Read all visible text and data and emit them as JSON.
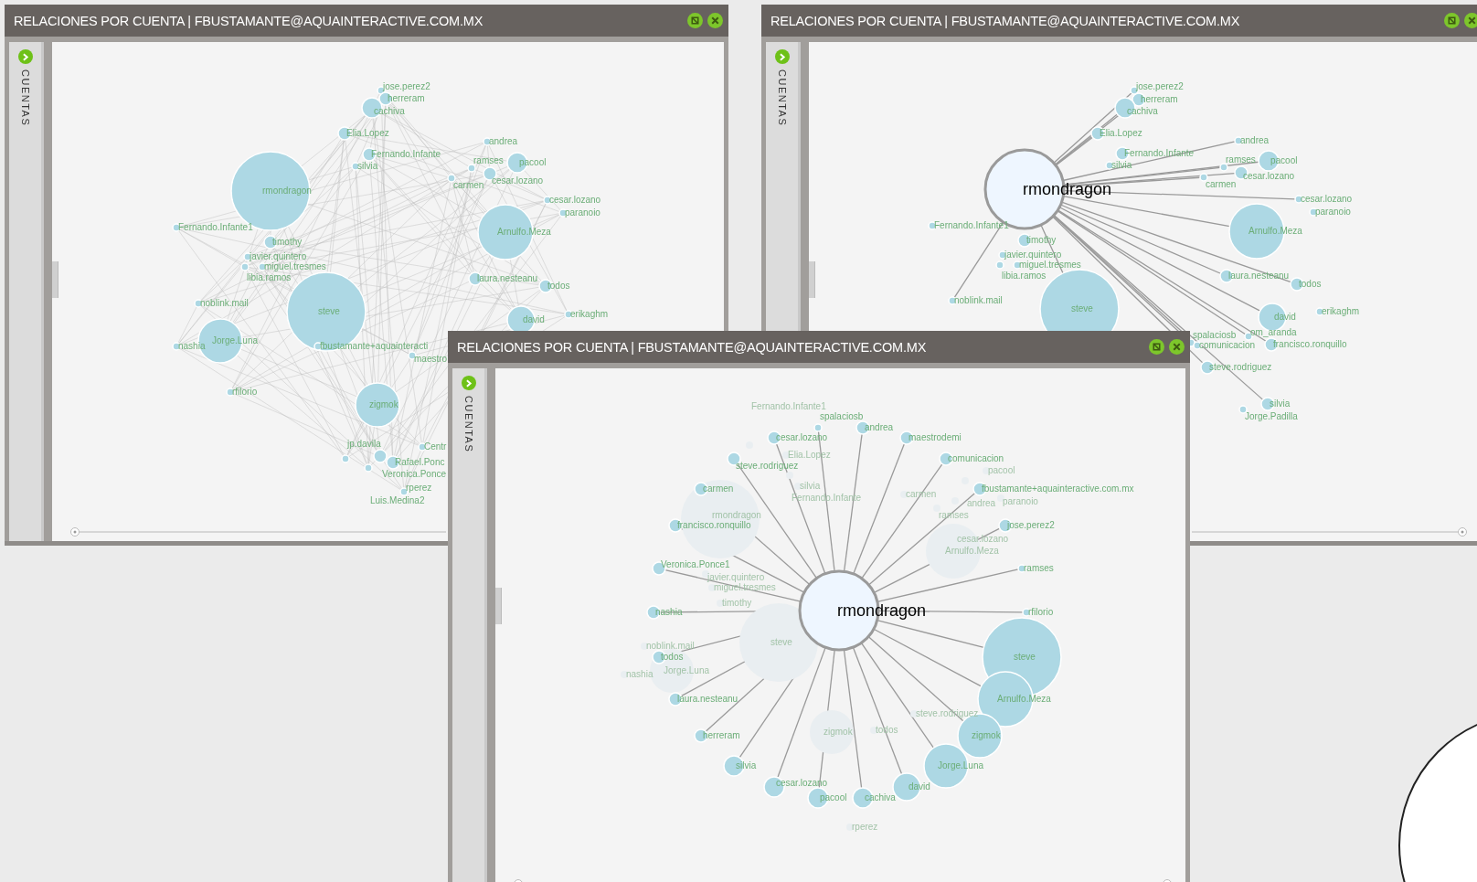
{
  "windows": [
    {
      "title": "RELACIONES POR CUENTA | FBUSTAMANTE@AQUAINTERACTIVE.COM.MX",
      "sidebar_label": "CUENTAS",
      "nodes": [
        {
          "label": "jose.perez2",
          "kind": "dot"
        },
        {
          "label": "herreram",
          "kind": "minor"
        },
        {
          "label": "cachiva",
          "kind": "small"
        },
        {
          "label": "Elia.Lopez",
          "kind": "minor"
        },
        {
          "label": "andrea",
          "kind": "dot"
        },
        {
          "label": "Fernando.Infante",
          "kind": "minor"
        },
        {
          "label": "silvia",
          "kind": "dot"
        },
        {
          "label": "ramses",
          "kind": "dot"
        },
        {
          "label": "pacool",
          "kind": "small"
        },
        {
          "label": "cesar.lozano",
          "kind": "minor"
        },
        {
          "label": "carmen",
          "kind": "dot"
        },
        {
          "label": "rmondragon",
          "kind": "huge"
        },
        {
          "label": "cesar.lozano",
          "kind": "dot"
        },
        {
          "label": "paranoio",
          "kind": "dot"
        },
        {
          "label": "Fernando.Infante1",
          "kind": "dot"
        },
        {
          "label": "Arnulfo.Meza",
          "kind": "large"
        },
        {
          "label": "timothy",
          "kind": "minor"
        },
        {
          "label": "javier.quintero",
          "kind": "dot"
        },
        {
          "label": "miguel.tresmes",
          "kind": "dot"
        },
        {
          "label": "libia.ramos",
          "kind": "dot"
        },
        {
          "label": "laura.nesteanu",
          "kind": "minor"
        },
        {
          "label": "todos",
          "kind": "minor"
        },
        {
          "label": "noblink.mail",
          "kind": "dot"
        },
        {
          "label": "steve",
          "kind": "huge"
        },
        {
          "label": "erikaghm",
          "kind": "dot"
        },
        {
          "label": "david",
          "kind": "medium"
        },
        {
          "label": "Jorge.Luna",
          "kind": "big"
        },
        {
          "label": "nashia",
          "kind": "dot"
        },
        {
          "label": "fbustamante+aquainteracti",
          "kind": "dot"
        },
        {
          "label": "maestro",
          "kind": "dot"
        },
        {
          "label": "rfilorio",
          "kind": "dot"
        },
        {
          "label": "zigmok",
          "kind": "big"
        },
        {
          "label": "Centr",
          "kind": "dot"
        },
        {
          "label": "Veronica.Ponce",
          "kind": "minor"
        },
        {
          "label": "jp.davila",
          "kind": "dot"
        },
        {
          "label": "Rafael.Ponc",
          "kind": "minor"
        },
        {
          "label": "Luis.Medina2",
          "kind": "dot"
        },
        {
          "label": "rperez",
          "kind": "dot"
        }
      ]
    },
    {
      "title": "RELACIONES POR CUENTA | FBUSTAMANTE@AQUAINTERACTIVE.COM.MX",
      "sidebar_label": "CUENTAS",
      "focus": {
        "label": "rmondragon",
        "kind": "huge",
        "neighbors": [
          {
            "label": "jose.perez2",
            "kind": "dot"
          },
          {
            "label": "herreram",
            "kind": "minor"
          },
          {
            "label": "cachiva",
            "kind": "small"
          },
          {
            "label": "Elia.Lopez",
            "kind": "minor"
          },
          {
            "label": "andrea",
            "kind": "dot"
          },
          {
            "label": "pacool",
            "kind": "small"
          },
          {
            "label": "ramses",
            "kind": "dot"
          },
          {
            "label": "cesar.lozano",
            "kind": "minor"
          },
          {
            "label": "carmen",
            "kind": "dot"
          },
          {
            "label": "cesar.lozano",
            "kind": "dot"
          },
          {
            "label": "Arnulfo.Meza",
            "kind": "large"
          },
          {
            "label": "laura.nesteanu",
            "kind": "minor"
          },
          {
            "label": "todos",
            "kind": "minor"
          },
          {
            "label": "noblink.mail",
            "kind": "dot"
          },
          {
            "label": "steve",
            "kind": "huge"
          },
          {
            "label": "david",
            "kind": "medium"
          },
          {
            "label": "om_aranda",
            "kind": "dot"
          },
          {
            "label": "spalaciosb",
            "kind": "dot"
          },
          {
            "label": "comunicacion",
            "kind": "dot"
          },
          {
            "label": "francisco.ronquillo",
            "kind": "minor"
          },
          {
            "label": "steve.rodriguez",
            "kind": "minor"
          },
          {
            "label": "silvia",
            "kind": "minor"
          }
        ]
      },
      "nodes": [
        {
          "label": "Fernando.Infante",
          "kind": "minor"
        },
        {
          "label": "silvia",
          "kind": "dot"
        },
        {
          "label": "paranoio",
          "kind": "dot"
        },
        {
          "label": "Fernando.Infante1",
          "kind": "dot"
        },
        {
          "label": "timothy",
          "kind": "minor"
        },
        {
          "label": "javier.quintero",
          "kind": "dot"
        },
        {
          "label": "miguel.tresmes",
          "kind": "dot"
        },
        {
          "label": "libia.ramos",
          "kind": "dot"
        },
        {
          "label": "erikaghm",
          "kind": "dot"
        },
        {
          "label": "Jorge.Padilla",
          "kind": "dot"
        }
      ]
    },
    {
      "title": "RELACIONES POR CUENTA | FBUSTAMANTE@AQUAINTERACTIVE.COM.MX",
      "sidebar_label": "CUENTAS",
      "background_nodes": [
        {
          "label": "Fernando.Infante1",
          "kind": "dot"
        },
        {
          "label": "Elia.Lopez",
          "kind": "dot"
        },
        {
          "label": "pacool",
          "kind": "dot"
        },
        {
          "label": "Fernando.Infante",
          "kind": "dot"
        },
        {
          "label": "andrea",
          "kind": "dot"
        },
        {
          "label": "silvia",
          "kind": "dot"
        },
        {
          "label": "carmen",
          "kind": "dot"
        },
        {
          "label": "paranoio",
          "kind": "dot"
        },
        {
          "label": "cesar.lozano",
          "kind": "dot"
        },
        {
          "label": "ramses",
          "kind": "dot"
        },
        {
          "label": "rmondragon",
          "kind": "huge"
        },
        {
          "label": "Arnulfo.Meza",
          "kind": "large"
        },
        {
          "label": "javier.quintero",
          "kind": "dot"
        },
        {
          "label": "miguel.tresmes",
          "kind": "dot"
        },
        {
          "label": "timothy",
          "kind": "dot"
        },
        {
          "label": "steve",
          "kind": "huge"
        },
        {
          "label": "noblink.mail",
          "kind": "dot"
        },
        {
          "label": "Jorge.Luna",
          "kind": "big"
        },
        {
          "label": "nashia",
          "kind": "dot"
        },
        {
          "label": "steve.rodriguez",
          "kind": "dot"
        },
        {
          "label": "todos",
          "kind": "dot"
        },
        {
          "label": "zigmok",
          "kind": "big"
        },
        {
          "label": "rperez",
          "kind": "dot"
        }
      ],
      "focus": {
        "label": "rmondragon",
        "kind": "huge",
        "neighbors": [
          {
            "label": "spalaciosb",
            "kind": "dot"
          },
          {
            "label": "andrea",
            "kind": "minor"
          },
          {
            "label": "cesar.lozano",
            "kind": "minor"
          },
          {
            "label": "maestrodemi",
            "kind": "minor"
          },
          {
            "label": "steve.rodriguez",
            "kind": "minor"
          },
          {
            "label": "comunicacion",
            "kind": "minor"
          },
          {
            "label": "carmen",
            "kind": "minor"
          },
          {
            "label": "fbustamante+aquainteractive.com.mx",
            "kind": "minor"
          },
          {
            "label": "francisco.ronquillo",
            "kind": "minor"
          },
          {
            "label": "jose.perez2",
            "kind": "minor"
          },
          {
            "label": "Veronica.Ponce1",
            "kind": "minor"
          },
          {
            "label": "ramses",
            "kind": "dot"
          },
          {
            "label": "nashia",
            "kind": "minor"
          },
          {
            "label": "rfilorio",
            "kind": "dot"
          },
          {
            "label": "todos",
            "kind": "minor"
          },
          {
            "label": "steve",
            "kind": "huge"
          },
          {
            "label": "laura.nesteanu",
            "kind": "minor"
          },
          {
            "label": "Arnulfo.Meza",
            "kind": "large"
          },
          {
            "label": "herreram",
            "kind": "minor"
          },
          {
            "label": "zigmok",
            "kind": "big"
          },
          {
            "label": "silvia",
            "kind": "small"
          },
          {
            "label": "Jorge.Luna",
            "kind": "big"
          },
          {
            "label": "cesar.lozano",
            "kind": "small"
          },
          {
            "label": "david",
            "kind": "medium"
          },
          {
            "label": "pacool",
            "kind": "small"
          },
          {
            "label": "cachiva",
            "kind": "small"
          }
        ]
      }
    }
  ]
}
